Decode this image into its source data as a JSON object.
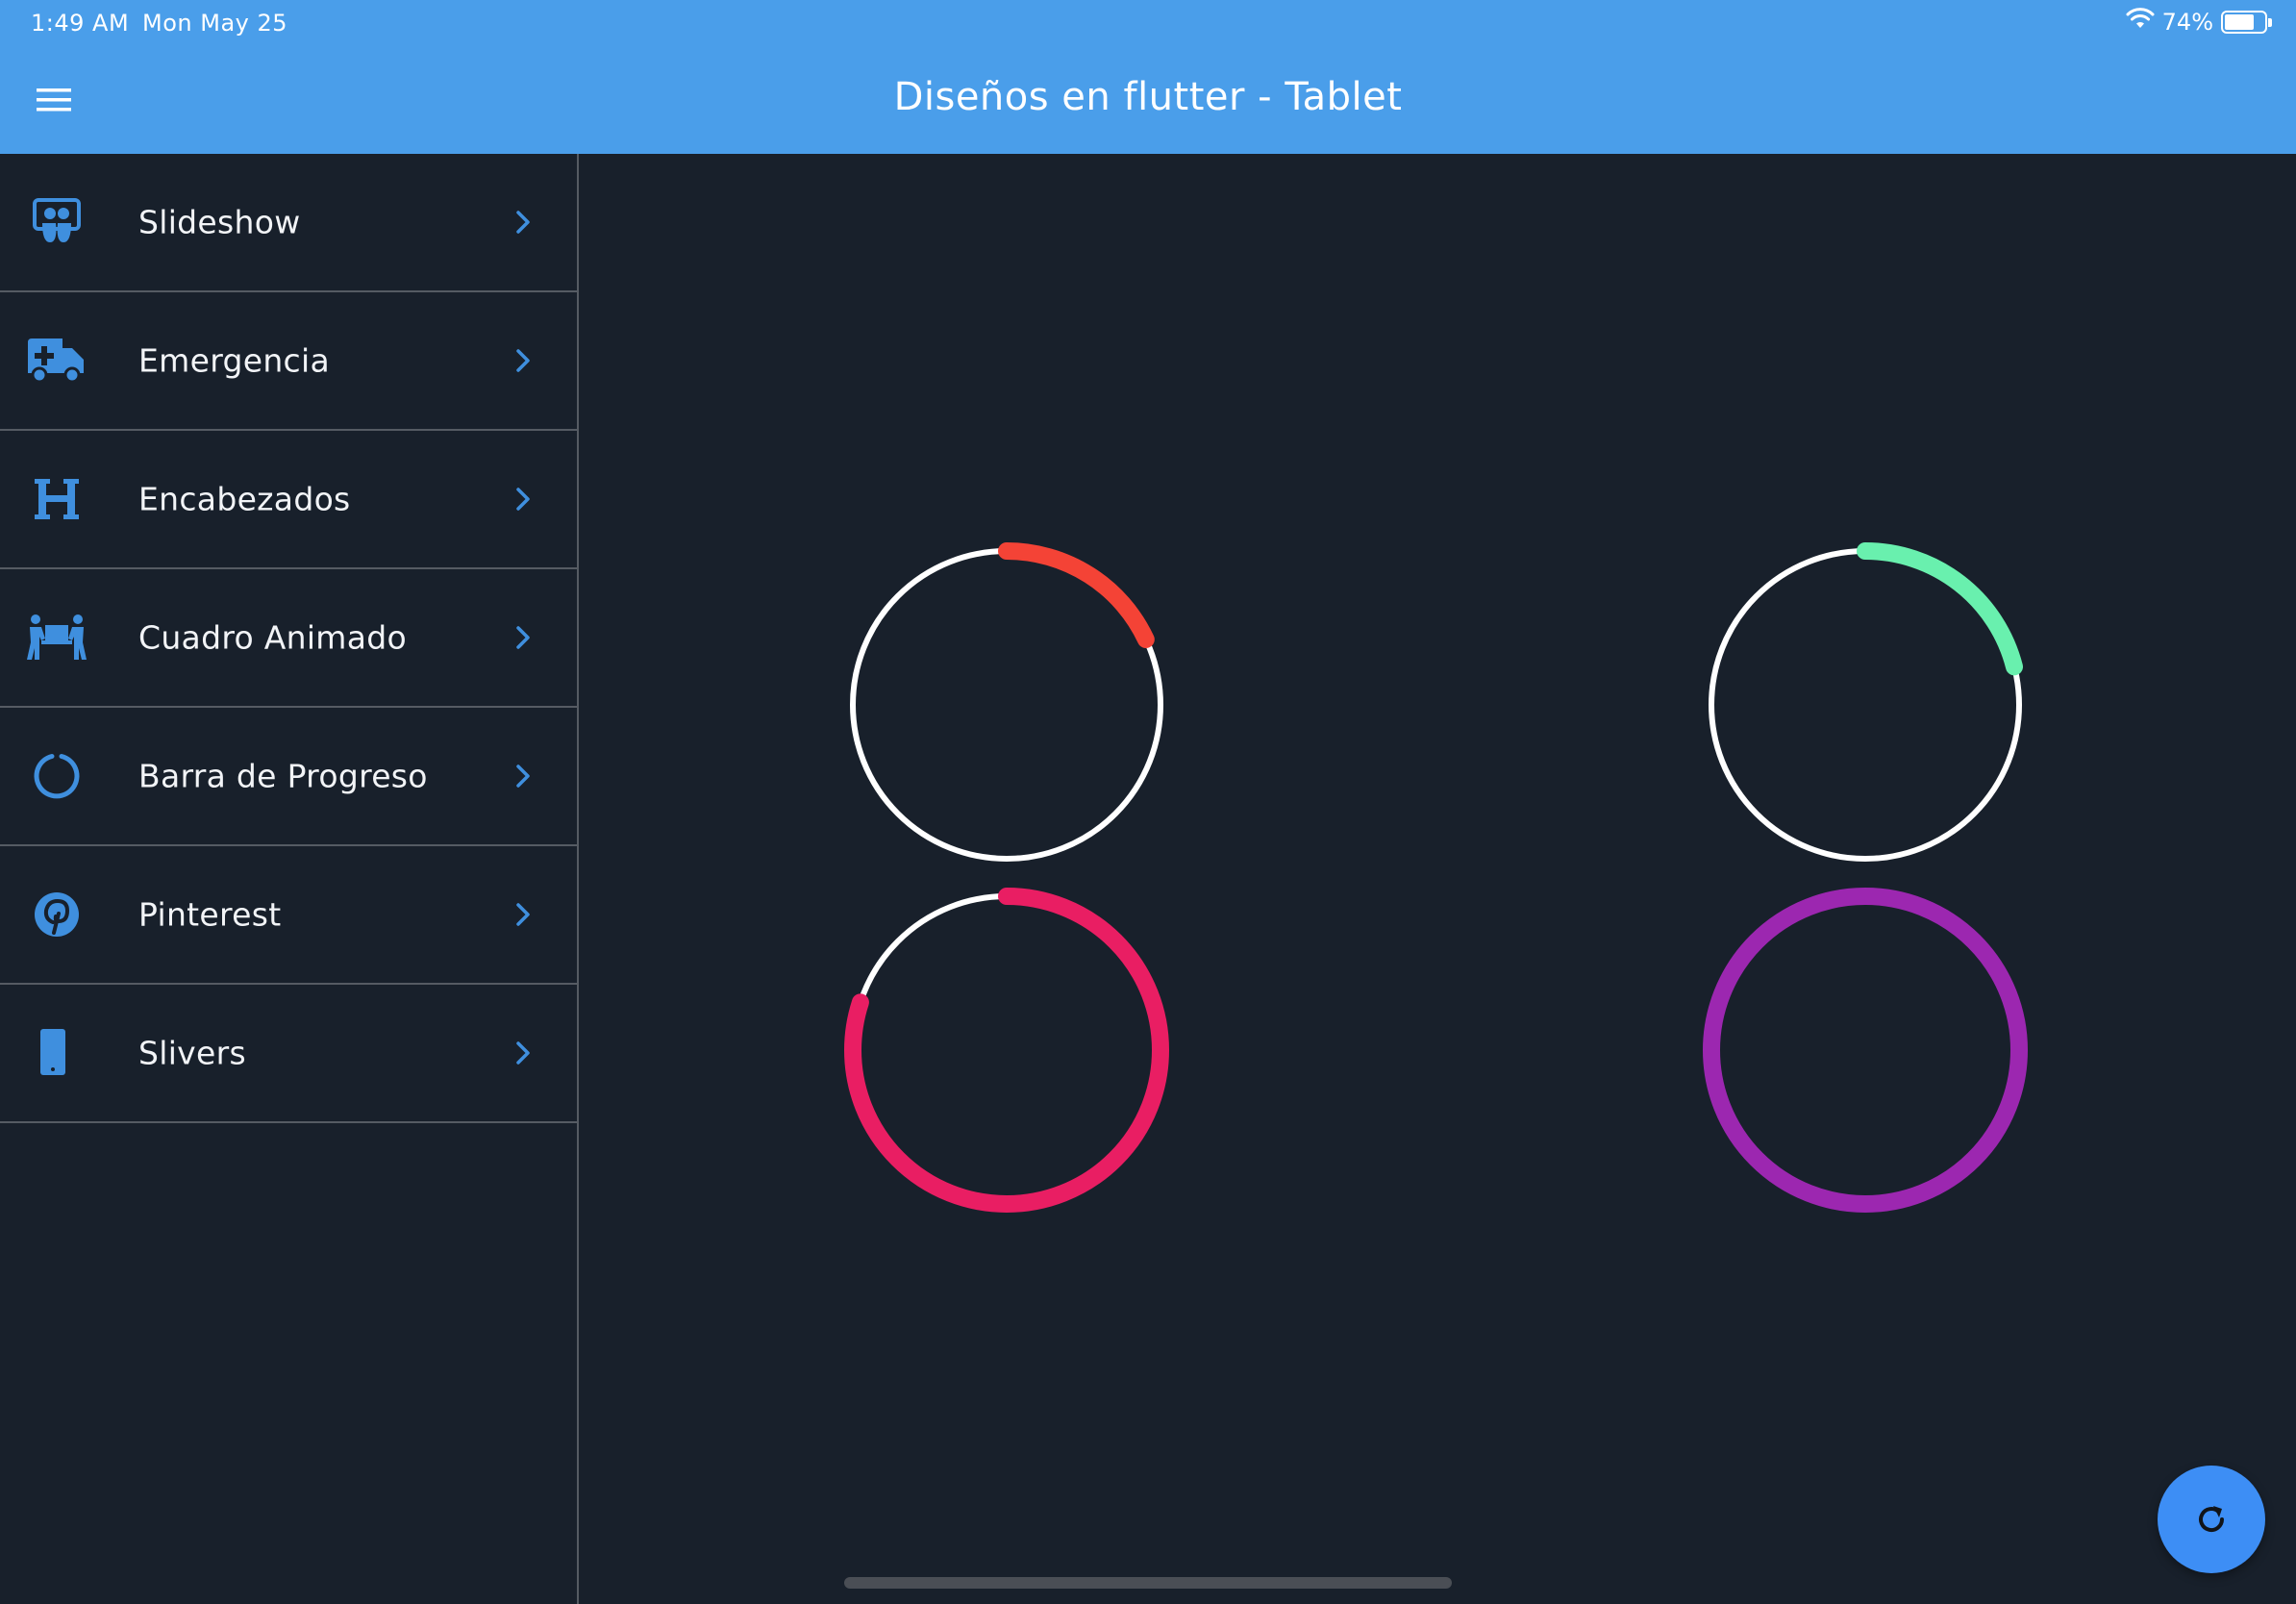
{
  "status_bar": {
    "time": "1:49 AM",
    "date": "Mon May 25",
    "battery": "74%",
    "battery_level": 0.74,
    "wifi_icon": "wifi-icon"
  },
  "app_bar": {
    "title": "Diseños en flutter - Tablet",
    "menu_icon": "menu-icon",
    "color": "#4a9eea"
  },
  "sidebar": {
    "items": [
      {
        "label": "Slideshow",
        "icon": "slideshow-icon"
      },
      {
        "label": "Emergencia",
        "icon": "ambulance-icon"
      },
      {
        "label": "Encabezados",
        "icon": "heading-icon"
      },
      {
        "label": "Cuadro Animado",
        "icon": "people-carry-icon"
      },
      {
        "label": "Barra de Progreso",
        "icon": "circle-notch-icon"
      },
      {
        "label": "Pinterest",
        "icon": "pinterest-icon"
      },
      {
        "label": "Slivers",
        "icon": "mobile-icon"
      }
    ],
    "chevron_icon": "chevron-right-icon",
    "accent": "#3f8fde"
  },
  "progress_rings": [
    {
      "progress": 0.18,
      "color": "#f44336",
      "track": "#ffffff"
    },
    {
      "progress": 0.21,
      "color": "#69f0ae",
      "track": "#ffffff"
    },
    {
      "progress": 0.8,
      "color": "#e91e63",
      "track": "#ffffff"
    },
    {
      "progress": 1.0,
      "color": "#9c27b0",
      "track": "#ffffff"
    }
  ],
  "fab": {
    "icon": "refresh-icon",
    "color": "#3d8ef5"
  },
  "background": "#18202b"
}
